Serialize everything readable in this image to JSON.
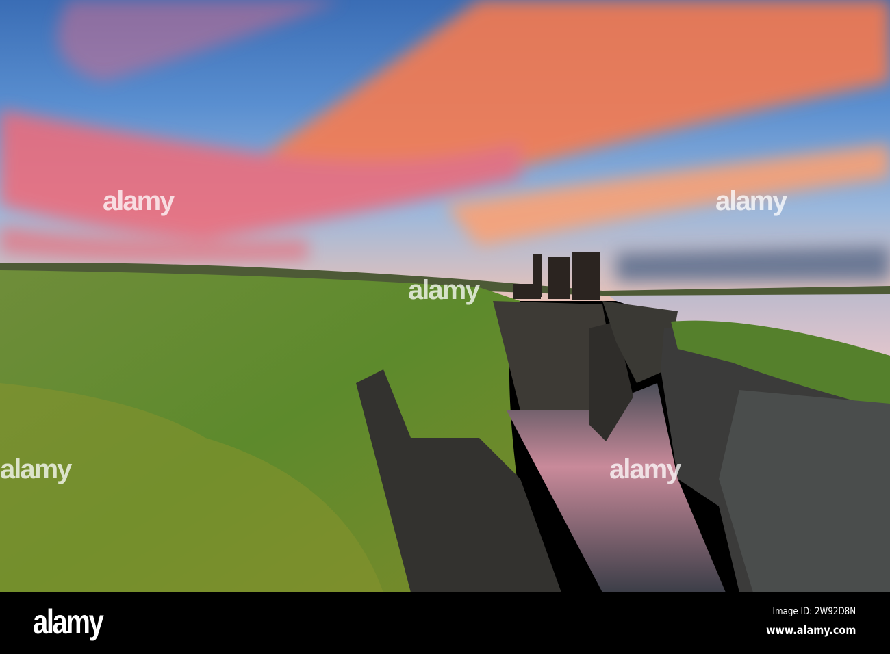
{
  "watermark": {
    "text": "alamy"
  },
  "footer": {
    "logo": "alamy",
    "image_id": "Image ID: 2W92D8N",
    "site": "www.alamy.com"
  },
  "colors": {
    "sky_top": "#3a6fb8",
    "sunset": "#ff7a4a",
    "grass": "#5f8a2e",
    "cliff": "#2e2c2a",
    "sea": "#c8b4bf"
  }
}
